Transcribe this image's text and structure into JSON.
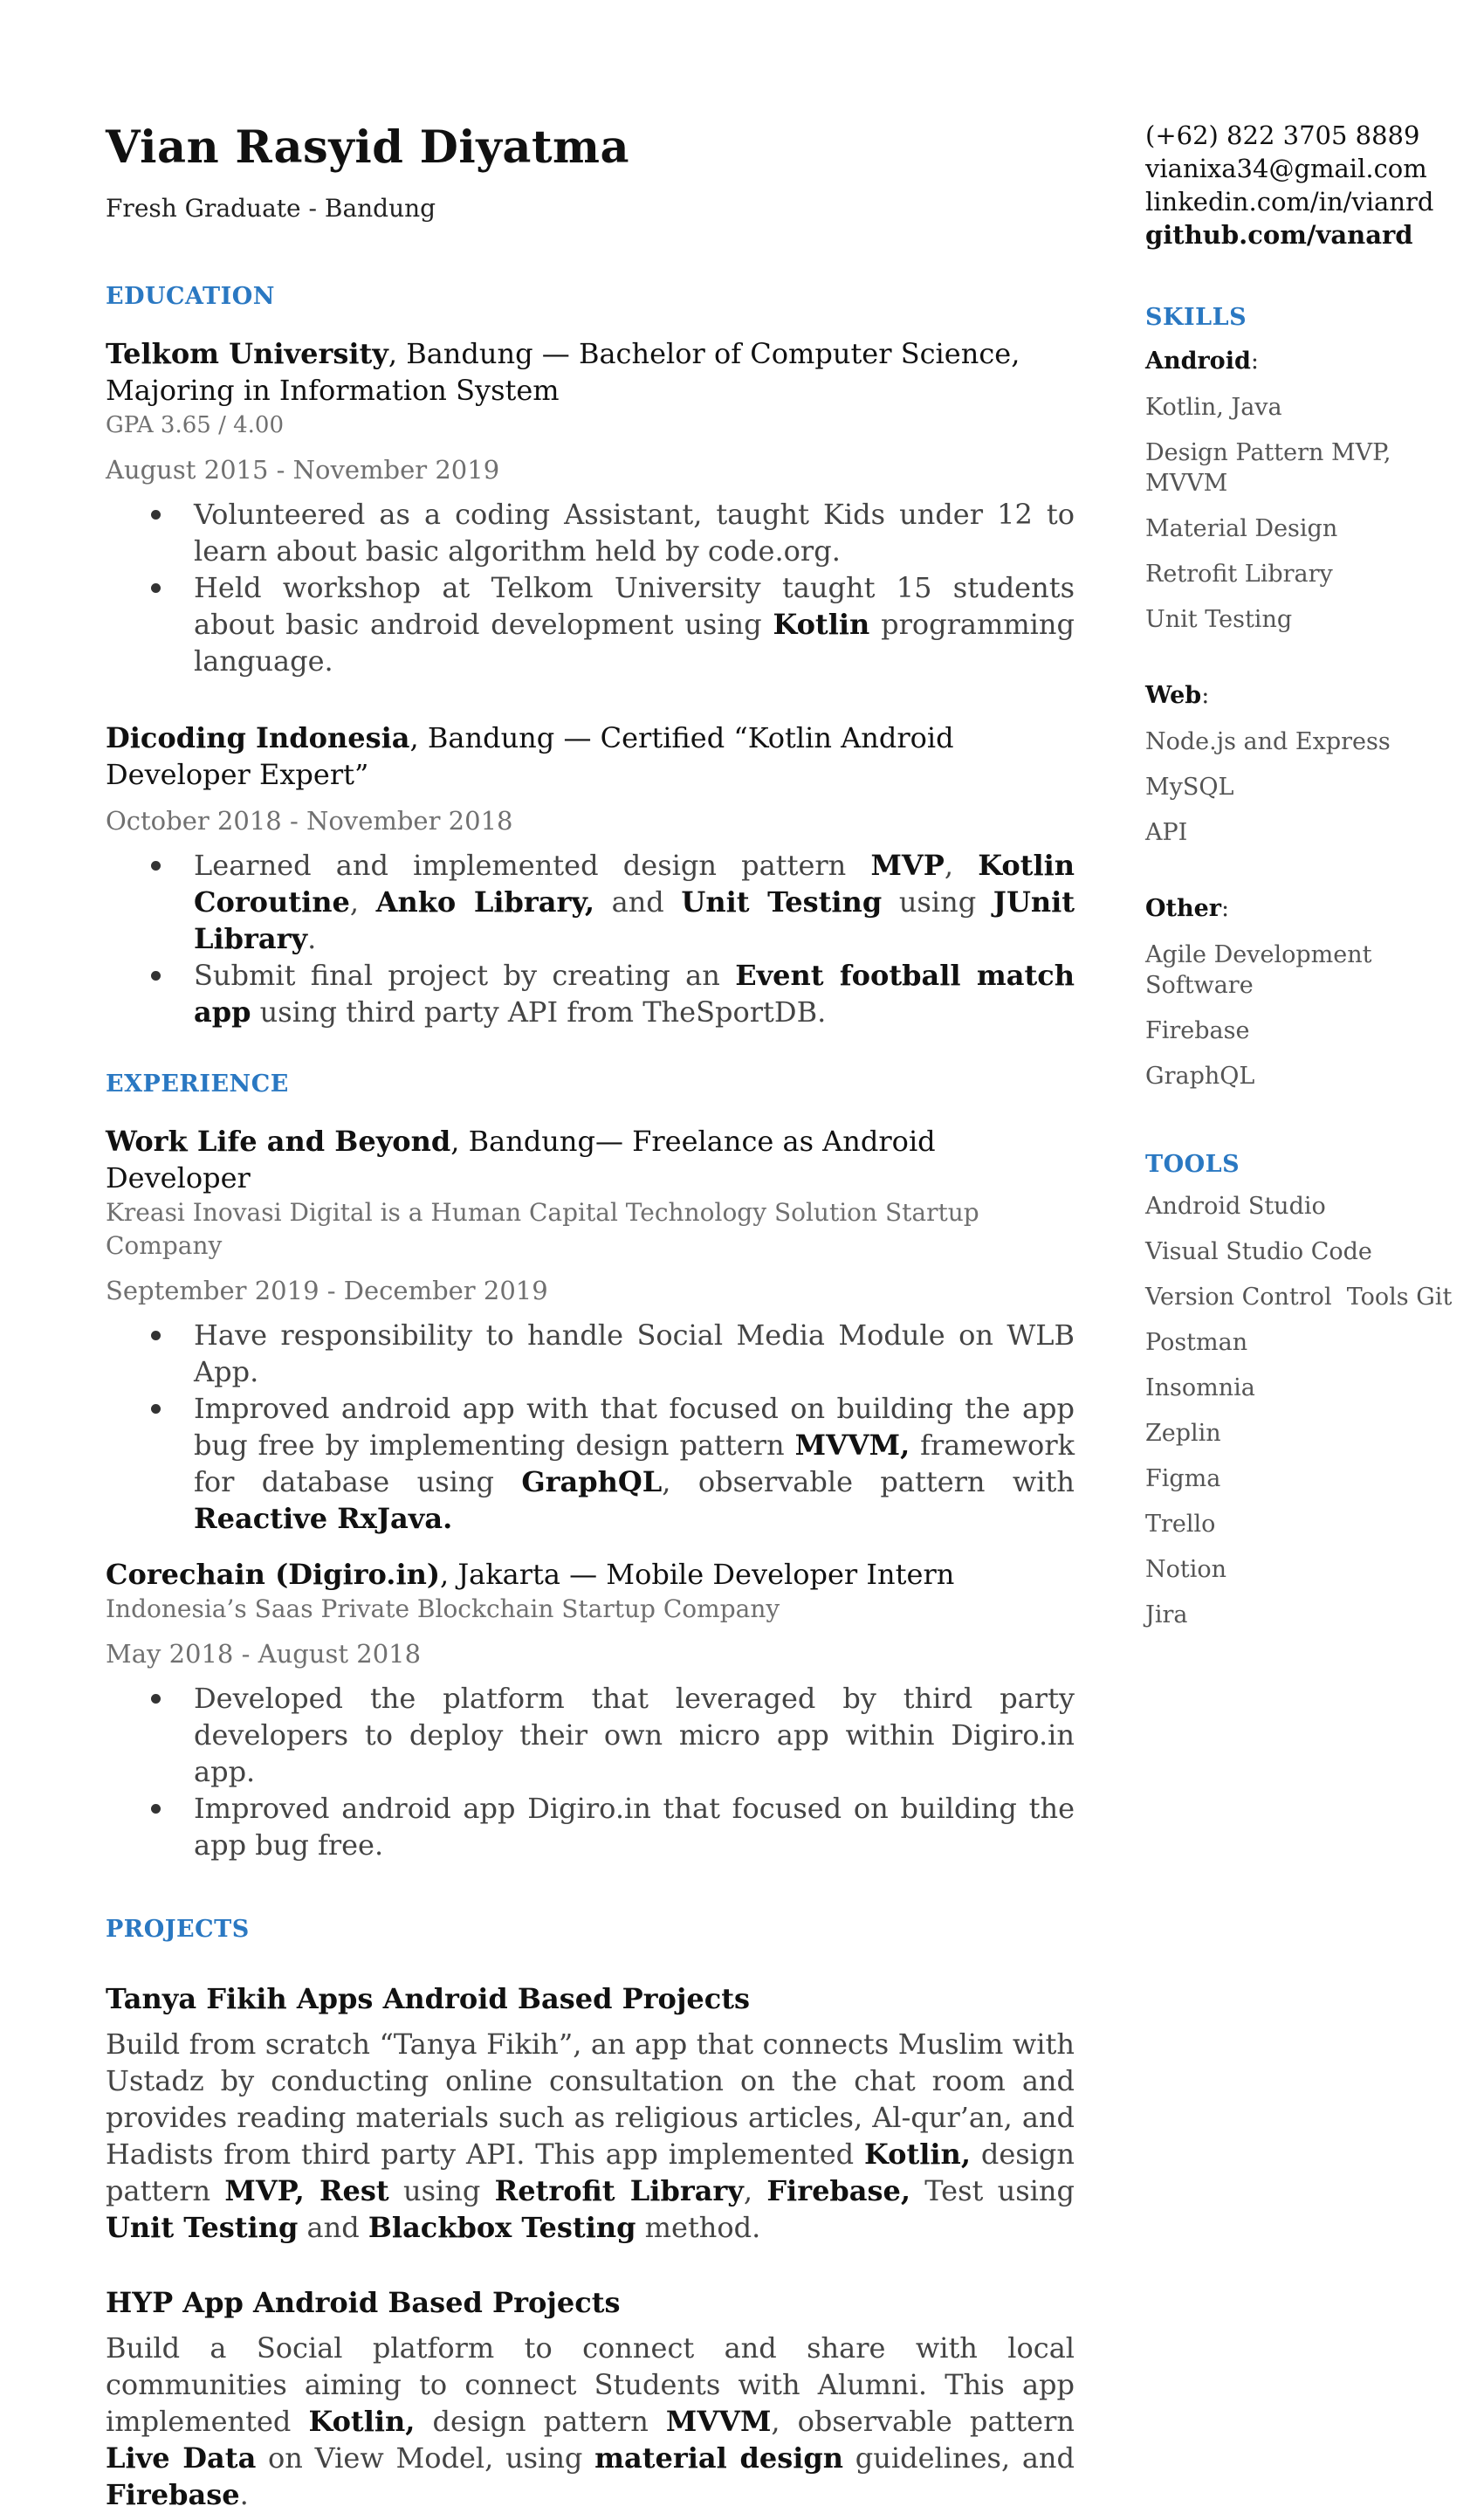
{
  "header": {
    "name": "Vian Rasyid Diyatma",
    "subtitle": "Fresh Graduate - Bandung"
  },
  "contact": {
    "phone": "(+62) 822 3705 8889",
    "email": "vianixa34@gmail.com",
    "linkedin": "linkedin.com/in/vianrd",
    "github": "github.com/vanard"
  },
  "education": {
    "title": "EDUCATION",
    "telkom": {
      "org": "Telkom University",
      "rest": ", Bandung — Bachelor of Computer Science, Majoring in Information System",
      "gpa": "GPA 3.65 / 4.00",
      "date": "August 2015 - November 2019",
      "bullet1": "Volunteered as a coding Assistant, taught Kids under 12 to learn about basic algorithm held by code.org.",
      "bullet2_a": "Held workshop at Telkom University taught 15 students about basic android development using ",
      "bullet2_kotlin": "Kotlin",
      "bullet2_b": " programming language."
    },
    "dicoding": {
      "org": "Dicoding Indonesia",
      "rest": ", Bandung — Certified “Kotlin Android Developer Expert”",
      "date": "October 2018 - November 2018",
      "b1_a": "Learned and implemented design pattern ",
      "b1_mvp": "MVP",
      "b1_sep1": ", ",
      "b1_coroutine": "Kotlin Coroutine",
      "b1_sep2": ", ",
      "b1_anko": "Anko Library,",
      "b1_and": " and ",
      "b1_unit": "Unit Testing",
      "b1_using": " using ",
      "b1_junit": "JUnit Library",
      "b1_end": ".",
      "b2_a": "Submit final project by creating an ",
      "b2_app": "Event football match app",
      "b2_b": " using third party API from TheSportDB."
    }
  },
  "experience": {
    "title": "EXPERIENCE",
    "wlb": {
      "org": "Work Life and Beyond",
      "rest": ", Bandung— Freelance as Android Developer",
      "desc": "Kreasi Inovasi Digital is a Human Capital Technology Solution Startup Company",
      "date": "September 2019 - December 2019",
      "b1": "Have responsibility to handle Social Media Module on WLB App.",
      "b2_a": "Improved android app with that focused on building the app bug free by implementing design pattern ",
      "b2_mvvm": "MVVM,",
      "b2_b": " framework for database using ",
      "b2_graphql": "GraphQL",
      "b2_c": ", observable pattern with ",
      "b2_rx": "Reactive RxJava."
    },
    "corechain": {
      "org": "Corechain (Digiro.in)",
      "rest": ", Jakarta — Mobile Developer Intern",
      "desc": "Indonesia’s Saas Private Blockchain Startup Company",
      "date": "May 2018 - August 2018",
      "b1": "Developed the platform that leveraged by third party developers to deploy their own micro app within Digiro.in app.",
      "b2": "Improved android app Digiro.in that focused on building the app bug free."
    }
  },
  "projects": {
    "title": "PROJECTS",
    "tanya": {
      "title": "Tanya Fikih Apps Android Based Projects",
      "p_a": "Build from scratch “Tanya Fikih”, an app that connects Muslim with Ustadz by conducting online consultation on the chat room and provides reading materials such as religious articles, Al-qur’an, and Hadists from third party API.  This app implemented ",
      "kotlin": "Kotlin,",
      "p_b": " design pattern ",
      "mvp": "MVP, Rest",
      "p_c": " using ",
      "retrofit": "Retrofit Library",
      "p_d": ", ",
      "firebase": "Firebase,",
      "p_e": " Test using ",
      "unit": "Unit Testing",
      "p_f": " and ",
      "blackbox": "Blackbox Testing",
      "p_g": " method."
    },
    "hyp": {
      "title": "HYP App Android Based Projects",
      "p_a": "Build a Social platform to connect and share with local communities aiming to connect Students with Alumni.  This app implemented ",
      "kotlin": "Kotlin,",
      "p_b": " design pattern ",
      "mvvm": "MVVM",
      "p_c": ", observable pattern ",
      "livedata": "Live Data",
      "p_d": " on View Model, using ",
      "material": "material design",
      "p_e": " guidelines, and ",
      "firebase": "Firebase",
      "p_f": "."
    }
  },
  "skills": {
    "title": "SKILLS",
    "android_label": "Android",
    "android_items": [
      "Kotlin, Java",
      "Design Pattern MVP, MVVM",
      "Material Design",
      "Retrofit Library",
      "Unit Testing"
    ],
    "web_label": "Web",
    "web_items": [
      "Node.js and Express",
      "MySQL",
      "API"
    ],
    "other_label": "Other",
    "other_items": [
      "Agile Development Software",
      "Firebase",
      "GraphQL"
    ],
    "colon": ":"
  },
  "tools": {
    "title": "TOOLS",
    "items": [
      "Android Studio",
      "Visual Studio Code",
      "Version Control  Tools Git",
      "Postman",
      "Insomnia",
      "Zeplin",
      "Figma",
      "Trello",
      "Notion",
      "Jira"
    ]
  }
}
